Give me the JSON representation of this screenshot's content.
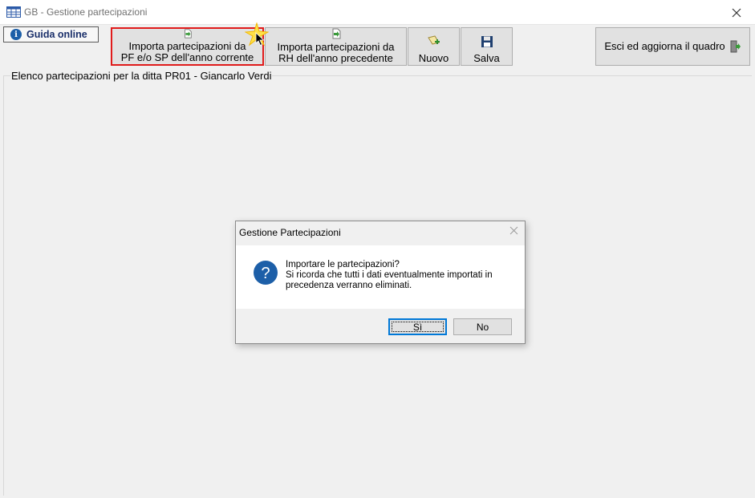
{
  "window": {
    "title": "GB - Gestione partecipazioni",
    "app_icon": "table-grid-icon",
    "close_icon": "close-icon"
  },
  "toolbar": {
    "help_label": "Guida online",
    "import_pf_line1": "Importa partecipazioni da",
    "import_pf_line2": "PF e/o SP dell'anno corrente",
    "import_rh_line1": "Importa partecipazioni da",
    "import_rh_line2": "RH dell'anno precedente",
    "nuovo_label": "Nuovo",
    "salva_label": "Salva",
    "esci_label": "Esci ed aggiorna il quadro"
  },
  "main": {
    "group_label": "Elenco partecipazioni per la ditta PR01 - Giancarlo Verdi"
  },
  "dialog": {
    "title": "Gestione Partecipazioni",
    "message_line1": "Importare le partecipazioni?",
    "message_line2": "Si ricorda che tutti i dati eventualmente importati in",
    "message_line3": "precedenza verranno eliminati.",
    "yes_label": "Sì",
    "no_label": "No"
  },
  "colors": {
    "highlight_border": "#e01b1b",
    "question_icon": "#1d5fa8",
    "focus_border": "#0078d7"
  }
}
